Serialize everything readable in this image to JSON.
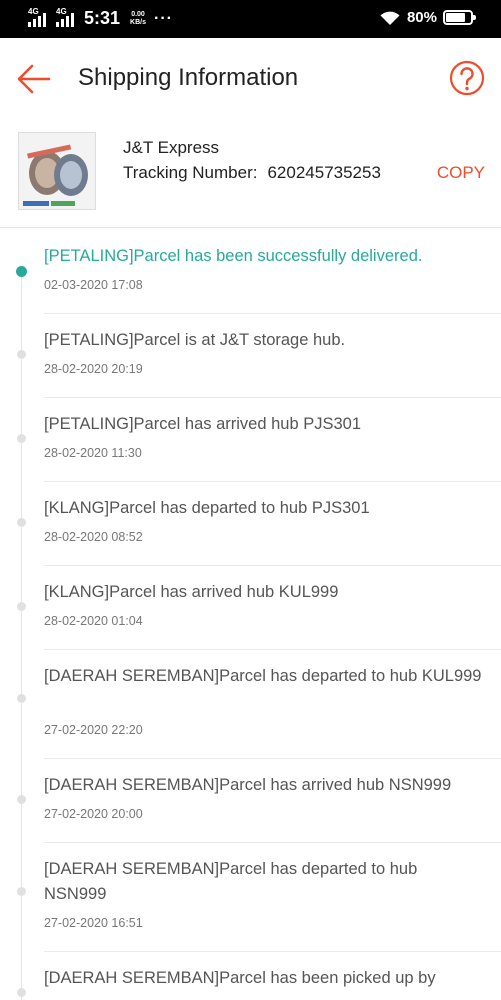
{
  "status_bar": {
    "network1": "4G",
    "network2": "4G",
    "time": "5:31",
    "speed_value": "0.00",
    "speed_unit": "KB/s",
    "more": "···",
    "battery": "80%",
    "battery_level": 0.8
  },
  "header": {
    "title": "Shipping Information",
    "back_icon": "arrow-left-icon",
    "help_icon": "question-circle-icon"
  },
  "carrier": {
    "name": "J&T Express",
    "tracking_label": "Tracking Number:",
    "tracking_number": "620245735253",
    "copy_label": "COPY"
  },
  "colors": {
    "accent": "#ee4d2d",
    "delivered": "#26aa99"
  },
  "events": [
    {
      "text": "[PETALING]Parcel has been successfully delivered.",
      "time": "02-03-2020 17:08",
      "active": true
    },
    {
      "text": "[PETALING]Parcel is at J&T storage hub.",
      "time": "28-02-2020 20:19"
    },
    {
      "text": "[PETALING]Parcel has arrived hub PJS301",
      "time": "28-02-2020 11:30"
    },
    {
      "text": "[KLANG]Parcel has departed to hub PJS301",
      "time": "28-02-2020 08:52"
    },
    {
      "text": "[KLANG]Parcel has arrived hub KUL999",
      "time": "28-02-2020 01:04"
    },
    {
      "text": "[DAERAH SEREMBAN]Parcel has departed to hub KUL999",
      "time": "27-02-2020 22:20"
    },
    {
      "text": "[DAERAH SEREMBAN]Parcel has arrived hub NSN999",
      "time": "27-02-2020 20:00"
    },
    {
      "text": "[DAERAH SEREMBAN]Parcel has departed to hub NSN999",
      "time": "27-02-2020 16:51"
    },
    {
      "text": "[DAERAH SEREMBAN]Parcel has been picked up by",
      "time": ""
    }
  ]
}
